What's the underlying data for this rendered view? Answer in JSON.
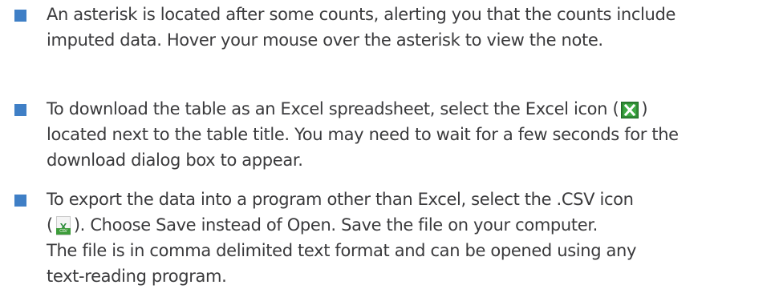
{
  "bullets": [
    {
      "lines": [
        "An asterisk is located after some counts, alerting you that the counts include",
        "imputed data. Hover your mouse over the asterisk to view the note."
      ]
    },
    {
      "line1_before_icon": "To download the table as an Excel spreadsheet, select the Excel icon (",
      "line1_after_icon": ")",
      "lines_rest": [
        "located next to the table title. You may need to wait for a few seconds for the",
        "download dialog box to appear."
      ],
      "icon": "excel-icon"
    },
    {
      "line1": "To export the data into a program other than Excel, select the .CSV icon",
      "line2_before_icon": "(",
      "line2_after_icon": "). Choose Save instead of Open. Save the file on your computer.",
      "lines_rest": [
        "The file is in comma delimited text format and can be opened using any",
        "text-reading program."
      ],
      "icon": "csv-icon",
      "icon_text": "CSV"
    }
  ],
  "colors": {
    "bullet": "#3f7fc6",
    "text": "#3a3a3c",
    "excel_green": "#2f8a34"
  }
}
